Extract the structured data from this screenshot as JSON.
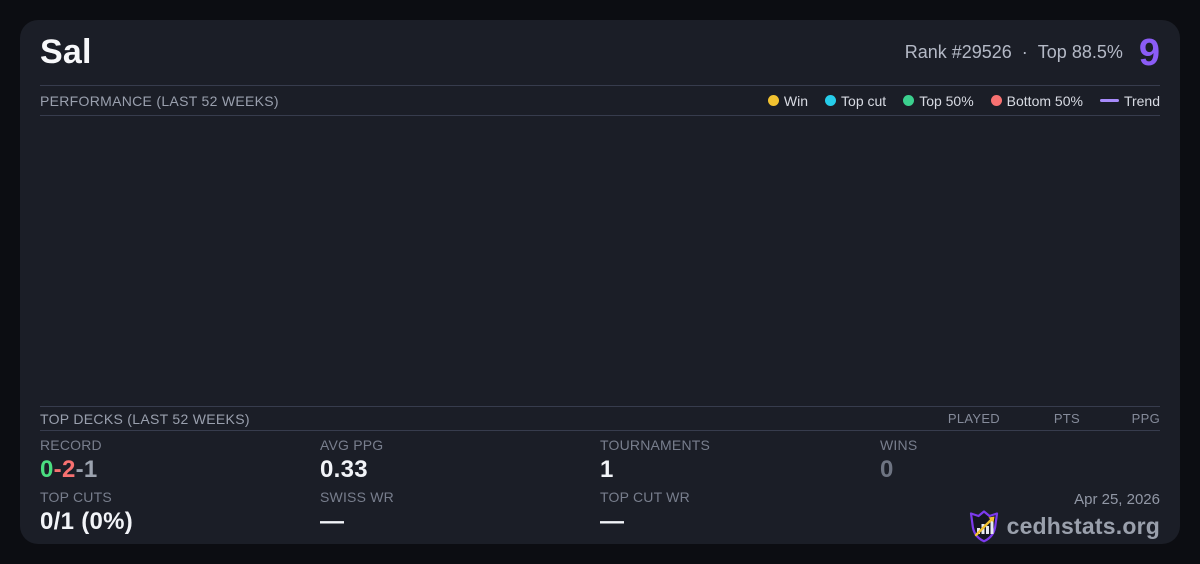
{
  "colors": {
    "accent_purple": "#8b5cf6",
    "win_yellow": "#f2c230",
    "top_cut_cyan": "#26cdea",
    "top50_green": "#3bd08e",
    "bottom50_red": "#f87171",
    "trend_purple": "#a78bfa",
    "record_green": "#4ade80",
    "record_red": "#f87171",
    "record_gray": "#9ca3af"
  },
  "header": {
    "player_name": "Sal",
    "rank": "Rank #29526",
    "dot_separator": "·",
    "top_percent": "Top 88.5%",
    "score_badge": "9"
  },
  "performance": {
    "title": "PERFORMANCE (LAST 52 WEEKS)",
    "legend": [
      {
        "label": "Win",
        "color": "#f2c230",
        "swatch": "dot"
      },
      {
        "label": "Top cut",
        "color": "#26cdea",
        "swatch": "dot"
      },
      {
        "label": "Top 50%",
        "color": "#3bd08e",
        "swatch": "dot"
      },
      {
        "label": "Bottom 50%",
        "color": "#f87171",
        "swatch": "dot"
      },
      {
        "label": "Trend",
        "color": "#a78bfa",
        "swatch": "line"
      }
    ]
  },
  "chart_data": {
    "type": "scatter",
    "title": "PERFORMANCE (LAST 52 WEEKS)",
    "x": [],
    "series": [
      {
        "name": "Win",
        "values": []
      },
      {
        "name": "Top cut",
        "values": []
      },
      {
        "name": "Top 50%",
        "values": []
      },
      {
        "name": "Bottom 50%",
        "values": []
      },
      {
        "name": "Trend",
        "values": []
      }
    ]
  },
  "top_decks": {
    "title": "TOP DECKS (LAST 52 WEEKS)",
    "columns": [
      "PLAYED",
      "PTS",
      "PPG"
    ],
    "rows": []
  },
  "stats": {
    "record": {
      "label": "RECORD",
      "wins": "0",
      "losses": "-2",
      "draws": "-1"
    },
    "avg_ppg": {
      "label": "AVG PPG",
      "value": "0.33"
    },
    "tournaments": {
      "label": "TOURNAMENTS",
      "value": "1"
    },
    "wins": {
      "label": "WINS",
      "value": "0"
    },
    "top_cuts": {
      "label": "TOP CUTS",
      "value": "0/1 (0%)"
    },
    "swiss_wr": {
      "label": "SWISS WR",
      "value": "—"
    },
    "top_cut_wr": {
      "label": "TOP CUT WR",
      "value": "—"
    }
  },
  "footer": {
    "date": "Apr 25, 2026",
    "brand": "cedhstats.org"
  }
}
